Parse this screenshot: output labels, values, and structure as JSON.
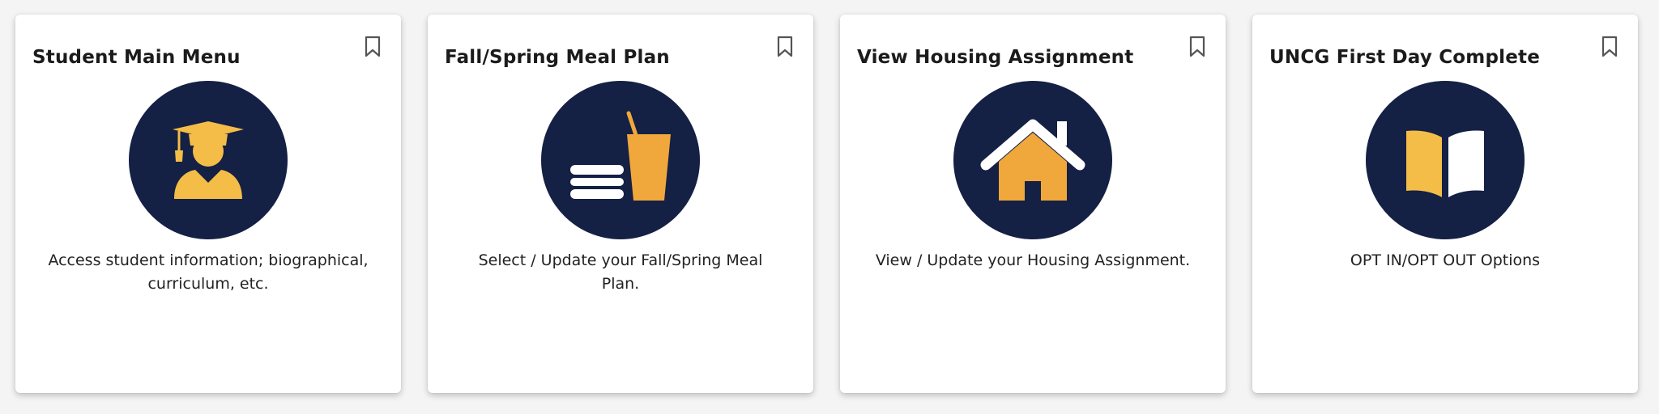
{
  "colors": {
    "circle": "#142044",
    "gold_light": "#f3bd48",
    "gold_dark": "#f0a73b"
  },
  "cards": [
    {
      "title": "Student Main Menu",
      "description": "Access student information; biographical, curriculum, etc.",
      "icon": "graduate-icon",
      "bookmark_icon": "bookmark-icon"
    },
    {
      "title": "Fall/Spring Meal Plan",
      "description": "Select / Update your Fall/Spring Meal Plan.",
      "icon": "meal-icon",
      "bookmark_icon": "bookmark-icon"
    },
    {
      "title": "View Housing Assignment",
      "description": "View / Update your Housing Assignment.",
      "icon": "house-icon",
      "bookmark_icon": "bookmark-icon"
    },
    {
      "title": "UNCG First Day Complete",
      "description": "OPT IN/OPT OUT Options",
      "icon": "book-icon",
      "bookmark_icon": "bookmark-icon"
    }
  ]
}
